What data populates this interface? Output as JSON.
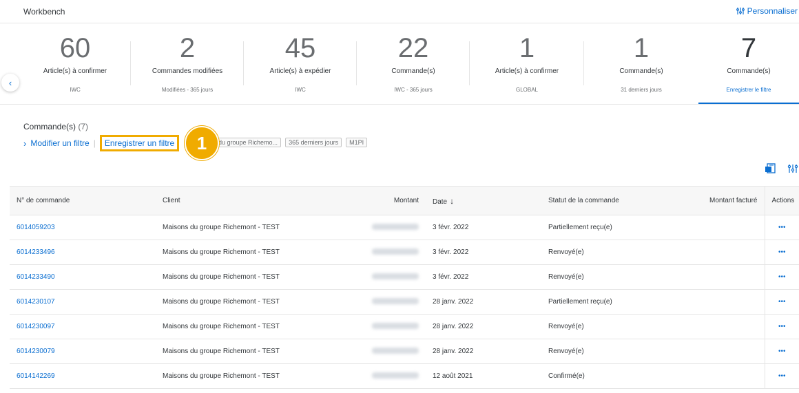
{
  "header": {
    "title": "Workbench",
    "personalize_label": "Personnaliser"
  },
  "tiles": [
    {
      "count": "60",
      "label": "Article(s) à confirmer",
      "sub": "IWC"
    },
    {
      "count": "2",
      "label": "Commandes modifiées",
      "sub": "Modifiées - 365 jours"
    },
    {
      "count": "45",
      "label": "Article(s) à expédier",
      "sub": "IWC"
    },
    {
      "count": "22",
      "label": "Commande(s)",
      "sub": "IWC - 365 jours"
    },
    {
      "count": "1",
      "label": "Article(s) à confirmer",
      "sub": "GLOBAL"
    },
    {
      "count": "1",
      "label": "Commande(s)",
      "sub": "31 derniers jours"
    },
    {
      "count": "7",
      "label": "Commande(s)",
      "sub": "Enregistrer le filtre",
      "active": true
    }
  ],
  "section": {
    "title": "Commande(s)",
    "count": "(7)",
    "modify_filter": "Modifier un filtre",
    "save_filter": "Enregistrer un filtre",
    "chips": [
      "du groupe Richemo...",
      "365 derniers jours",
      "M1PI"
    ]
  },
  "callout": {
    "number": "1",
    "color": "#f0ab00"
  },
  "table": {
    "columns": {
      "order_no": "N° de commande",
      "client": "Client",
      "amount": "Montant",
      "date": "Date",
      "status": "Statut de la commande",
      "invoiced": "Montant facturé",
      "actions": "Actions"
    },
    "rows": [
      {
        "order_no": "6014059203",
        "client": "Maisons du groupe Richemont - TEST",
        "date": "3 févr. 2022",
        "status": "Partiellement reçu(e)"
      },
      {
        "order_no": "6014233496",
        "client": "Maisons du groupe Richemont - TEST",
        "date": "3 févr. 2022",
        "status": "Renvoyé(e)"
      },
      {
        "order_no": "6014233490",
        "client": "Maisons du groupe Richemont - TEST",
        "date": "3 févr. 2022",
        "status": "Renvoyé(e)"
      },
      {
        "order_no": "6014230107",
        "client": "Maisons du groupe Richemont - TEST",
        "date": "28 janv. 2022",
        "status": "Partiellement reçu(e)"
      },
      {
        "order_no": "6014230097",
        "client": "Maisons du groupe Richemont - TEST",
        "date": "28 janv. 2022",
        "status": "Renvoyé(e)"
      },
      {
        "order_no": "6014230079",
        "client": "Maisons du groupe Richemont - TEST",
        "date": "28 janv. 2022",
        "status": "Renvoyé(e)"
      },
      {
        "order_no": "6014142269",
        "client": "Maisons du groupe Richemont - TEST",
        "date": "12 août 2021",
        "status": "Confirmé(e)"
      }
    ],
    "actions_glyph": "•••"
  },
  "colors": {
    "accent": "#0a6ed1",
    "highlight": "#f0ab00"
  }
}
